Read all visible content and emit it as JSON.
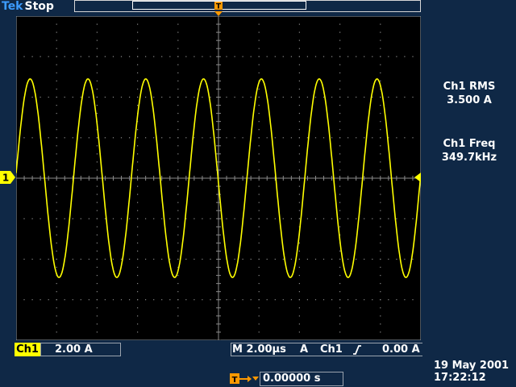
{
  "header": {
    "brand": "Tek",
    "acquisition_state": "Stop",
    "trigger_position_label": "T"
  },
  "waveform": {
    "channel_marker_label": "1",
    "cycles_on_screen": 7,
    "amplitude_divisions": 2.45,
    "color": "#ffff00"
  },
  "measurements": [
    {
      "label": "Ch1 RMS",
      "value": "3.500 A"
    },
    {
      "label": "Ch1 Freq",
      "value": "349.7kHz"
    }
  ],
  "status": {
    "channel_tag": "Ch1",
    "channel_scale": "2.00 A",
    "timebase": "M 2.00µs",
    "trigger_mode": "A",
    "trigger_source": "Ch1",
    "trigger_level": "0.00 A",
    "delay": "0.00000 s"
  },
  "timestamp": {
    "date": "19 May 2001",
    "time": "17:22:12"
  },
  "colors": {
    "background": "#0f2846",
    "screen": "#000000",
    "trace": "#ffff00",
    "grid": "#8a8a8a",
    "accent": "#ff9900"
  }
}
